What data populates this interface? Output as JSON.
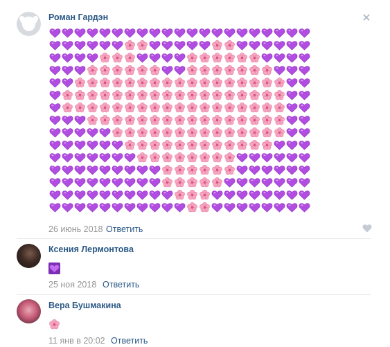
{
  "post": {
    "author": "Роман Гардэн",
    "date": "26 июнь 2018",
    "reply_label": "Ответить",
    "close_icon": "close-icon",
    "like_icon": "heart-like-icon",
    "emoji_art": {
      "heart": "💜",
      "flower": "🌸",
      "rows": [
        "hhhhhhhhhhhhhhhhhhhhh",
        "hhhhhhffhhhhhffhhhhhh",
        "hhhhfffhhhhffffffhhhh",
        "hhhffffffhhfffffffhhh",
        "hhfffffffffffffffffhh",
        "hffffffffffffffffffhh",
        "hffffffffffffffffffhh",
        "hhhffffffffffffffffhh",
        "hhhhhffffffffffffffhh",
        "hhhhhhffffffffffffhhh",
        "hhhhhhhffffffffhhhhhh",
        "hhhhhhhhhffffffhhhhhh",
        "hhhhhhhhhfffffhhhhhhh",
        "hhhhhhhhhhfffhhhhhhhh",
        "hhhhhhhhhhhffhhhhhhhh"
      ]
    }
  },
  "comments": [
    {
      "author": "Ксения Лермонтова",
      "emoji": "💜",
      "date": "25 ноя 2018",
      "reply_label": "Ответить"
    },
    {
      "author": "Вера Бушмакина",
      "emoji": "🌸",
      "date": "11 янв в 20:02",
      "reply_label": "Ответить"
    }
  ],
  "colors": {
    "link": "#2a5885",
    "meta": "#939393",
    "heart": "#b14de0",
    "flower": "#f6a6c1"
  }
}
